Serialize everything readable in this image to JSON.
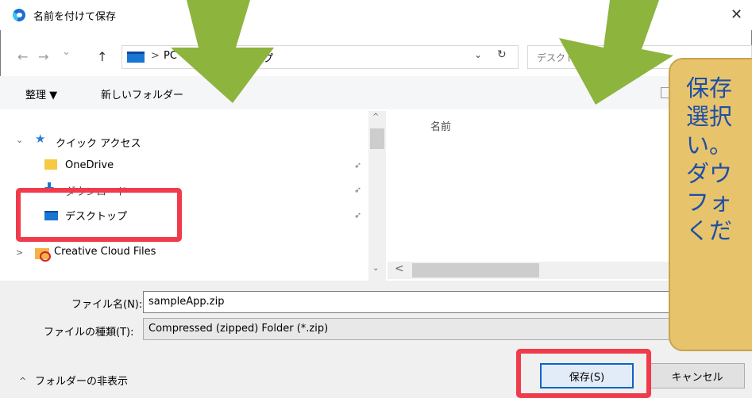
{
  "window": {
    "title": "名前を付けて保存",
    "close_glyph": "✕"
  },
  "nav": {
    "back_glyph": "←",
    "forward_glyph": "→",
    "recent_glyph": "⌄",
    "up_glyph": "↑",
    "address_sep": ">",
    "address_pc": "PC",
    "address_rest": "ップ",
    "address_dropdown": "⌄",
    "refresh_glyph": "↻",
    "search_placeholder": "デスクト"
  },
  "toolbar": {
    "organize_label": "整理 ▼",
    "new_folder_label": "新しいフォルダー"
  },
  "tree": {
    "quick_access": {
      "arrow": "⌄",
      "label": "クイック アクセス"
    },
    "items": [
      {
        "label": "OneDrive",
        "pin": "📌"
      },
      {
        "label": "ダウンロード",
        "pin": "📌"
      },
      {
        "label": "デスクトップ",
        "pin": "📌"
      }
    ],
    "creative_cloud": {
      "arrow": ">",
      "label": "Creative Cloud Files"
    }
  },
  "scroll": {
    "up": "^",
    "down": "⌄",
    "left": "<"
  },
  "file_pane": {
    "name_column": "名前"
  },
  "form": {
    "file_name_label": "ファイル名(N):",
    "file_name_value": "sampleApp.zip",
    "file_type_label": "ファイルの種類(T):",
    "file_type_value": "Compressed (zipped) Folder (*.zip)"
  },
  "footer": {
    "hide_arrow": "^",
    "hide_folders_label": "フォルダーの非表示"
  },
  "buttons": {
    "save_label": "保存(S)",
    "cancel_label": "キャンセル"
  },
  "callout": {
    "text": "保存\n選択\nい。\nダウ\nフォ\nくだ"
  },
  "colors": {
    "accent": "#0a64c8",
    "highlight": "#ef3b4b",
    "arrow": "#8db43d",
    "callout": "#e7c36c"
  }
}
